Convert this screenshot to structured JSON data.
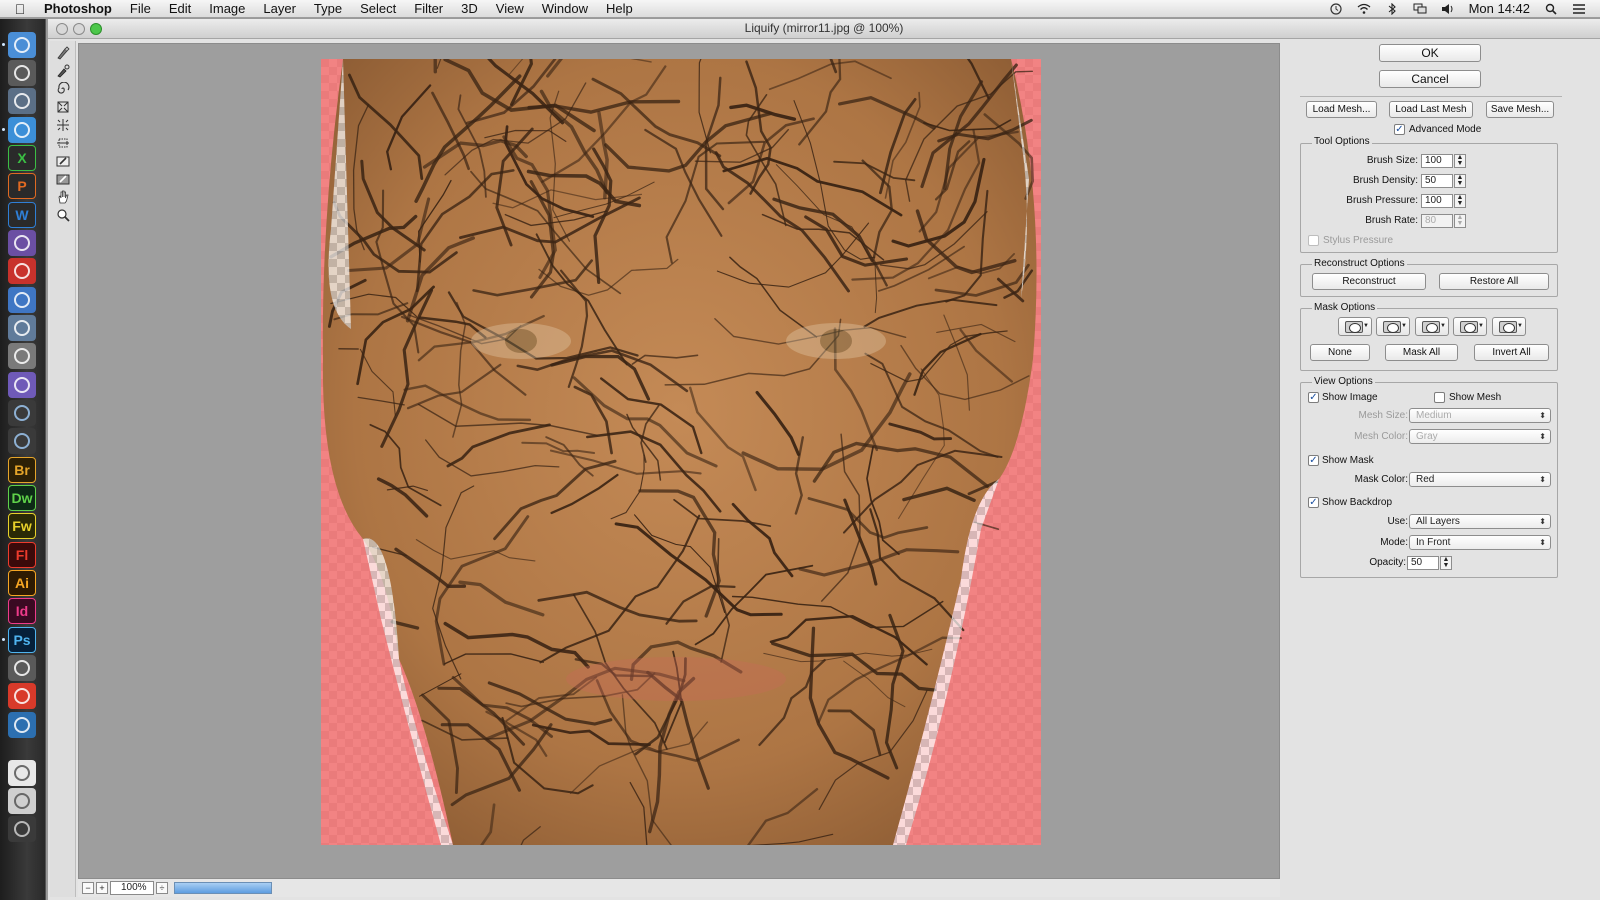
{
  "menubar": {
    "app_name": "Photoshop",
    "menus": [
      "File",
      "Edit",
      "Image",
      "Layer",
      "Type",
      "Select",
      "Filter",
      "3D",
      "View",
      "Window",
      "Help"
    ],
    "clock": "Mon 14:42"
  },
  "dock": {
    "items": [
      {
        "icon": "finder-icon",
        "label": "",
        "bg": "#4a8ed6",
        "fg": "#ffffff"
      },
      {
        "icon": "launchpad-icon",
        "label": "",
        "bg": "#5a5a5a",
        "fg": "#ffffff"
      },
      {
        "icon": "mission-control-icon",
        "label": "",
        "bg": "#5b6f86",
        "fg": "#ffffff"
      },
      {
        "icon": "safari-icon",
        "label": "",
        "bg": "#3c8fd8",
        "fg": "#ffffff"
      },
      {
        "icon": "excel-icon",
        "label": "X",
        "bg": "#2a2a2a",
        "fg": "#3bbf44"
      },
      {
        "icon": "powerpoint-icon",
        "label": "P",
        "bg": "#2a2a2a",
        "fg": "#e06a22"
      },
      {
        "icon": "word-icon",
        "label": "W",
        "bg": "#2a2a2a",
        "fg": "#2f7fd6"
      },
      {
        "icon": "itunes-icon",
        "label": "",
        "bg": "#6b4fa3",
        "fg": "#ffffff"
      },
      {
        "icon": "flash-icon",
        "label": "",
        "bg": "#c8322c",
        "fg": "#ffffff"
      },
      {
        "icon": "imovie-icon",
        "label": "",
        "bg": "#3f76c4",
        "fg": "#ffffff"
      },
      {
        "icon": "preview-icon",
        "label": "",
        "bg": "#607b9a",
        "fg": "#ffffff"
      },
      {
        "icon": "disk-utility-icon",
        "label": "",
        "bg": "#7a7a7a",
        "fg": "#ffffff"
      },
      {
        "icon": "photo-booth-icon",
        "label": "",
        "bg": "#6f5ab8",
        "fg": "#ffffff"
      },
      {
        "icon": "network-icon",
        "label": "",
        "bg": "#3a3a3a",
        "fg": "#9cc6ee"
      },
      {
        "icon": "bluetooth-icon",
        "label": "",
        "bg": "#3a3a3a",
        "fg": "#9cc6ee"
      },
      {
        "icon": "bridge-icon",
        "label": "Br",
        "bg": "#2d2006",
        "fg": "#e6a52a"
      },
      {
        "icon": "dreamweaver-icon",
        "label": "Dw",
        "bg": "#0d2a16",
        "fg": "#5fd24a"
      },
      {
        "icon": "fireworks-icon",
        "label": "Fw",
        "bg": "#2b2a06",
        "fg": "#e8d12a"
      },
      {
        "icon": "flash-pro-icon",
        "label": "Fl",
        "bg": "#3b0a0a",
        "fg": "#ee3b2c"
      },
      {
        "icon": "illustrator-icon",
        "label": "Ai",
        "bg": "#2e1a02",
        "fg": "#f6a623"
      },
      {
        "icon": "indesign-icon",
        "label": "Id",
        "bg": "#3a0a22",
        "fg": "#ee3b8a"
      },
      {
        "icon": "photoshop-icon",
        "label": "Ps",
        "bg": "#06203a",
        "fg": "#4fb4f0"
      },
      {
        "icon": "acrobat-icon",
        "label": "",
        "bg": "#5a5a5a",
        "fg": "#ffffff"
      },
      {
        "icon": "pdf-icon",
        "label": "",
        "bg": "#d83a2a",
        "fg": "#ffffff"
      },
      {
        "icon": "screen-share-icon",
        "label": "",
        "bg": "#2c6fb0",
        "fg": "#ffffff"
      },
      {
        "icon": "document-icon",
        "label": "",
        "bg": "#e8e8e8",
        "fg": "#555555"
      },
      {
        "icon": "photos-stack-icon",
        "label": "",
        "bg": "#cfcfcf",
        "fg": "#555555"
      },
      {
        "icon": "trash-icon",
        "label": "",
        "bg": "#3a3a3a",
        "fg": "#cfcfcf"
      }
    ]
  },
  "window": {
    "title": "Liquify (mirror11.jpg @ 100%)"
  },
  "statusbar": {
    "zoom": "100%"
  },
  "panel": {
    "ok": "OK",
    "cancel": "Cancel",
    "load_mesh": "Load Mesh...",
    "load_last_mesh": "Load Last Mesh",
    "save_mesh": "Save Mesh...",
    "advanced_mode": "Advanced Mode",
    "tool_options": {
      "title": "Tool Options",
      "brush_size_label": "Brush Size:",
      "brush_size": "100",
      "brush_density_label": "Brush Density:",
      "brush_density": "50",
      "brush_pressure_label": "Brush Pressure:",
      "brush_pressure": "100",
      "brush_rate_label": "Brush Rate:",
      "brush_rate": "80",
      "stylus_pressure": "Stylus Pressure"
    },
    "reconstruct_options": {
      "title": "Reconstruct Options",
      "reconstruct": "Reconstruct",
      "restore_all": "Restore All"
    },
    "mask_options": {
      "title": "Mask Options",
      "none": "None",
      "mask_all": "Mask All",
      "invert_all": "Invert All"
    },
    "view_options": {
      "title": "View Options",
      "show_image": "Show Image",
      "show_mesh": "Show Mesh",
      "mesh_size_label": "Mesh Size:",
      "mesh_size": "Medium",
      "mesh_color_label": "Mesh Color:",
      "mesh_color": "Gray",
      "show_mask": "Show Mask",
      "mask_color_label": "Mask Color:",
      "mask_color": "Red",
      "show_backdrop": "Show Backdrop",
      "use_label": "Use:",
      "use": "All Layers",
      "mode_label": "Mode:",
      "mode": "In Front",
      "opacity_label": "Opacity:",
      "opacity": "50"
    }
  },
  "colors": {
    "mask_red": "#ef6868",
    "texture_base": "#b47a48",
    "crack": "#3a2414"
  }
}
